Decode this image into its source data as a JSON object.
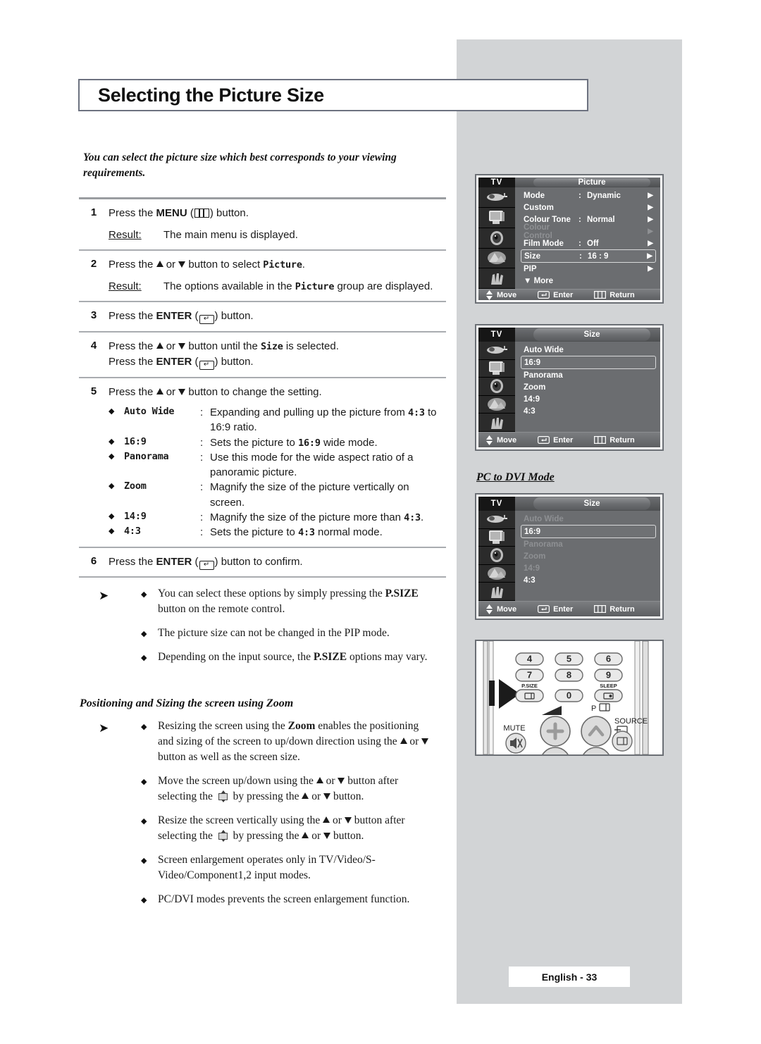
{
  "page": {
    "title": "Selecting the Picture Size",
    "intro": "You can select the picture size which best corresponds to your viewing requirements.",
    "footer": "English - 33"
  },
  "steps": [
    {
      "num": "1",
      "text_a": "Press the ",
      "bold_1": "MENU",
      "text_b": " (",
      "icon": "menu-icon",
      "text_c": ") button.",
      "result_label": "Result:",
      "result_text": "The main menu is displayed."
    },
    {
      "num": "2",
      "text_a": "Press the ",
      "text_b": " or ",
      "text_c": " button to select ",
      "mono_1": "Picture",
      "text_d": ".",
      "result_label": "Result:",
      "result_a": "The options available in the ",
      "result_mono": "Picture",
      "result_b": " group are displayed."
    },
    {
      "num": "3",
      "text_a": "Press the ",
      "bold_1": "ENTER",
      "text_b": " (",
      "text_c": ") button."
    },
    {
      "num": "4",
      "text_a": "Press the ",
      "text_b": " or ",
      "text_c": " button until the ",
      "mono_1": "Size",
      "text_d": " is selected.",
      "line2_a": "Press the ",
      "line2_bold": "ENTER",
      "line2_b": " (",
      "line2_c": ") button."
    },
    {
      "num": "5",
      "text_a": "Press the ",
      "text_b": " or ",
      "text_c": " button to change the setting."
    },
    {
      "num": "6",
      "text_a": "Press the ",
      "bold_1": "ENTER",
      "text_b": " (",
      "text_c": ") button to confirm."
    }
  ],
  "size_options": [
    {
      "name": "Auto Wide",
      "colon": ":",
      "desc_a": "Expanding and pulling up the picture from ",
      "desc_mono": "4:3",
      "desc_b": " to 16:9 ratio."
    },
    {
      "name": "16:9",
      "colon": ":",
      "desc_a": "Sets the picture to ",
      "desc_mono": "16:9",
      "desc_b": " wide mode."
    },
    {
      "name": "Panorama",
      "colon": ":",
      "desc_a": "Use this mode for the wide aspect ratio of a panoramic picture.",
      "desc_mono": "",
      "desc_b": ""
    },
    {
      "name": "Zoom",
      "colon": ":",
      "desc_a": "Magnify the size of the picture vertically on screen.",
      "desc_mono": "",
      "desc_b": ""
    },
    {
      "name": "14:9",
      "colon": ":",
      "desc_a": "Magnify the size of the picture more than ",
      "desc_mono": "4:3",
      "desc_b": "."
    },
    {
      "name": "4:3",
      "colon": ":",
      "desc_a": "Sets the picture to ",
      "desc_mono": "4:3",
      "desc_b": " normal mode."
    }
  ],
  "notes_1": [
    {
      "a": "You can select these options by simply pressing the ",
      "bold": "P.SIZE",
      "b": " button on the remote control."
    },
    {
      "a": "The picture size can not be changed in the PIP mode.",
      "bold": "",
      "b": ""
    },
    {
      "a": "Depending on the input source, the ",
      "bold": "P.SIZE",
      "b": " options may vary."
    }
  ],
  "subheading": "Positioning and Sizing the screen using Zoom",
  "notes_2": [
    {
      "a": "Resizing the screen using the ",
      "bold": "Zoom",
      "b": " enables the positioning and sizing of the screen to up/down direction using the ",
      "c": " or ",
      "d": " button as well as the screen size."
    },
    {
      "a": "Move the screen up/down using the ",
      "b": " or ",
      "c": " button after selecting the ",
      "icon": "screen-position-icon",
      "d": " by pressing the ",
      "e": " or ",
      "f": " button."
    },
    {
      "a": "Resize the screen vertically using the ",
      "b": " or ",
      "c": " button after selecting the ",
      "icon": "screen-resize-icon",
      "d": " by pressing the ",
      "e": " or ",
      "f": " button."
    },
    {
      "a": "Screen enlargement operates only in TV/Video/S-Video/Component1,2 input modes.",
      "bold": "",
      "b": ""
    },
    {
      "a": "PC/DVI modes prevents the screen enlargement function.",
      "bold": "",
      "b": ""
    }
  ],
  "osd": {
    "tv_label": "TV",
    "footer": {
      "move": "Move",
      "enter": "Enter",
      "return": "Return"
    },
    "icons": [
      "remote-icon",
      "tv-icon",
      "speaker-icon",
      "picture-icon",
      "hand-icon"
    ],
    "picture_menu": {
      "tab": "Picture",
      "rows": [
        {
          "label": "Mode",
          "colon": ":",
          "value": "Dynamic",
          "arrow": "▶",
          "state": "normal"
        },
        {
          "label": "Custom",
          "colon": "",
          "value": "",
          "arrow": "▶",
          "state": "normal"
        },
        {
          "label": "Colour Tone",
          "colon": ":",
          "value": "Normal",
          "arrow": "▶",
          "state": "normal"
        },
        {
          "label": "Colour Control",
          "colon": "",
          "value": "",
          "arrow": "▶",
          "state": "dim"
        },
        {
          "label": "Film Mode",
          "colon": ":",
          "value": "Off",
          "arrow": "▶",
          "state": "normal"
        },
        {
          "label": "Size",
          "colon": ":",
          "value": "16 : 9",
          "arrow": "▶",
          "state": "selected"
        },
        {
          "label": "PIP",
          "colon": "",
          "value": "",
          "arrow": "▶",
          "state": "normal"
        },
        {
          "label": "▼ More",
          "colon": "",
          "value": "",
          "arrow": "",
          "state": "normal"
        }
      ]
    },
    "size_menu": {
      "tab": "Size",
      "rows": [
        {
          "label": "Auto Wide",
          "state": "normal"
        },
        {
          "label": "16:9",
          "state": "selected"
        },
        {
          "label": "Panorama",
          "state": "normal"
        },
        {
          "label": "Zoom",
          "state": "normal"
        },
        {
          "label": "14:9",
          "state": "normal"
        },
        {
          "label": "4:3",
          "state": "normal"
        }
      ]
    },
    "pcdvi_heading": "PC to DVI Mode",
    "pcdvi_menu": {
      "tab": "Size",
      "rows": [
        {
          "label": "Auto Wide",
          "state": "dim"
        },
        {
          "label": "16:9",
          "state": "selected"
        },
        {
          "label": "Panorama",
          "state": "dim"
        },
        {
          "label": "Zoom",
          "state": "dim"
        },
        {
          "label": "14:9",
          "state": "dim"
        },
        {
          "label": "4:3",
          "state": "normal"
        }
      ]
    }
  },
  "remote": {
    "keys": [
      "4",
      "5",
      "6",
      "7",
      "8",
      "9",
      "0"
    ],
    "psize_label": "P.SIZE",
    "sleep_label": "SLEEP",
    "mute_label": "MUTE",
    "p_label": "P",
    "source_label": "SOURCE"
  }
}
